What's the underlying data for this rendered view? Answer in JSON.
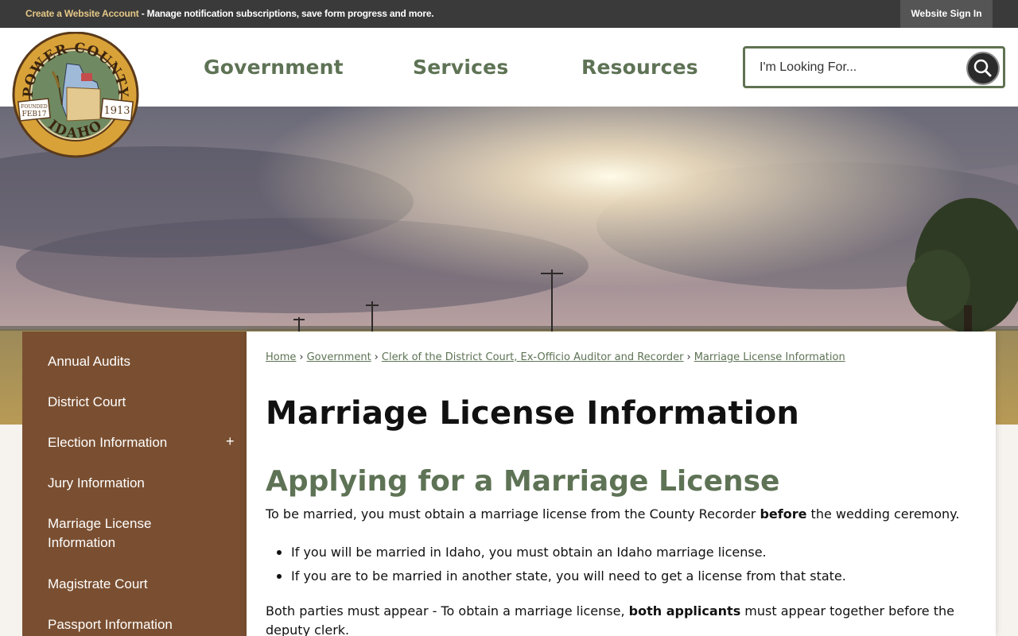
{
  "topbar": {
    "create_account_link": "Create a Website Account",
    "create_account_text": " - Manage notification subscriptions, save form progress and more.",
    "signin_label": "Website Sign In"
  },
  "logo": {
    "arc_top": "POWER COUNTY",
    "arc_bottom": "IDAHO",
    "founded_label": "FOUNDED",
    "founded_date": "FEB17",
    "founded_year": "1913"
  },
  "nav": {
    "items": [
      "Government",
      "Services",
      "Resources"
    ]
  },
  "search": {
    "placeholder": "I'm Looking For..."
  },
  "sidebar": {
    "items": [
      "Annual Audits",
      "District Court",
      "Election Information",
      "Jury Information",
      "Marriage License Information",
      "Magistrate Court",
      "Passport Information"
    ],
    "expand_symbol": "+"
  },
  "breadcrumb": {
    "items": [
      "Home",
      "Government",
      "Clerk of the District Court, Ex-Officio Auditor and Recorder",
      "Marriage License Information"
    ],
    "separator": "›"
  },
  "content": {
    "page_title": "Marriage License Information",
    "section_title": "Applying for a Marriage License",
    "intro_before": "To be married, you must obtain a marriage license from the County Recorder ",
    "intro_bold": "before",
    "intro_after": " the wedding ceremony.",
    "bullets": [
      "If you will be married in Idaho, you must obtain an Idaho marriage license.",
      "If you are to be married in another state, you will need to get a license from that state."
    ],
    "both_before": "Both parties must appear - To obtain a marriage license, ",
    "both_bold": "both applicants",
    "both_after": " must appear together before the deputy clerk."
  },
  "colors": {
    "accent_green": "#5e7355",
    "sidebar_brown": "#7a4f31",
    "topbar_dark": "#3a3a3a",
    "link_gold": "#e4c786"
  }
}
